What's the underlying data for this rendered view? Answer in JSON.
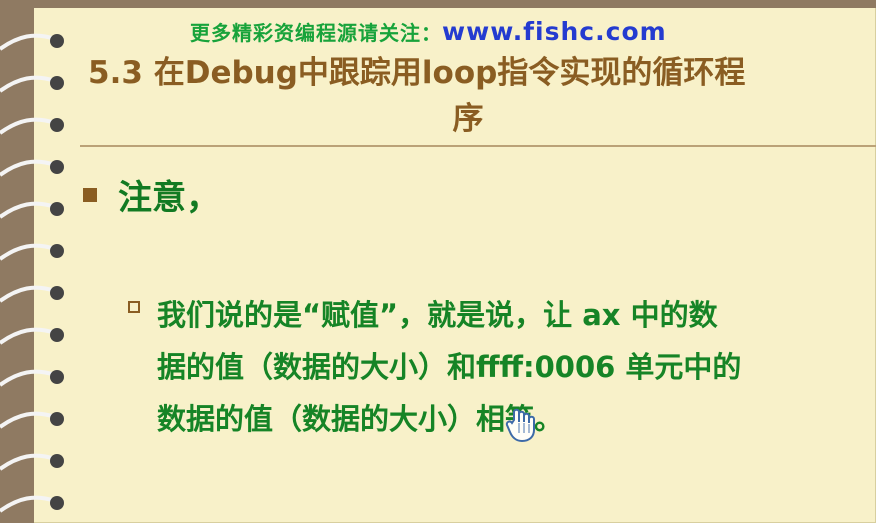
{
  "header": {
    "prefix": "更多精彩资编程源请关注：",
    "url": "www.fishc.com"
  },
  "slide": {
    "title_line_1": "5.3 在Debug中跟踪用loop指令实现的循环程",
    "title_line_2": "序",
    "main_bullet": "注意，",
    "body_line_1": "我们说的是“赋值”，就是说，让 ax 中的数",
    "body_line_2": "据的值（数据的大小）和ffff:0006 单元中的",
    "body_line_3": "数据的值（数据的大小）相等。"
  },
  "icons": {
    "spiral": "spiral-binding-icon",
    "cursor": "hand-cursor-icon"
  }
}
